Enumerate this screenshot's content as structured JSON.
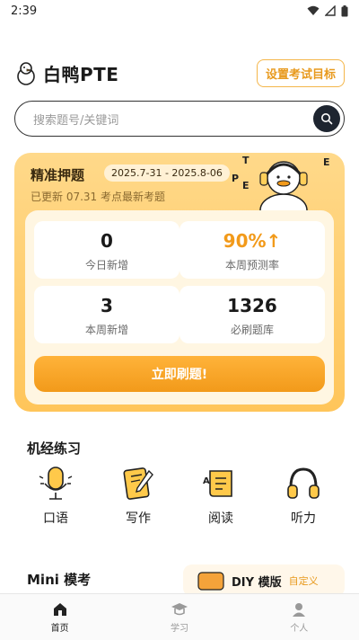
{
  "status_bar": {
    "time": "2:39"
  },
  "header": {
    "app_name": "白鸭PTE",
    "goal_button": "设置考试目标"
  },
  "search": {
    "placeholder": "搜索题号/关键词"
  },
  "promo": {
    "title": "精准押题",
    "date_range": "2025.7-31 - 2025.8-06",
    "updated": "已更新 07.31 考点最新考题",
    "stats": [
      {
        "value": "0",
        "label": "今日新增"
      },
      {
        "value": "90%↑",
        "label": "本周预测率"
      },
      {
        "value": "3",
        "label": "本周新增"
      },
      {
        "value": "1326",
        "label": "必刷题库"
      }
    ],
    "cta": "立即刷题!"
  },
  "practice": {
    "title": "机经练习",
    "items": [
      {
        "label": "口语",
        "icon": "microphone-icon"
      },
      {
        "label": "写作",
        "icon": "writing-icon"
      },
      {
        "label": "阅读",
        "icon": "reading-icon"
      },
      {
        "label": "听力",
        "icon": "headphones-icon"
      }
    ]
  },
  "mock": {
    "title": "Mini 模考"
  },
  "diy": {
    "badge": "DIY",
    "title": "DIY 模版",
    "tag": "自定义"
  },
  "tabs": [
    {
      "label": "首页",
      "icon": "home-icon"
    },
    {
      "label": "学习",
      "icon": "graduation-cap-icon"
    },
    {
      "label": "个人",
      "icon": "user-icon"
    }
  ],
  "colors": {
    "accent": "#f29a1a",
    "promo_bg": "#ffc55a",
    "dark": "#1e2530"
  }
}
